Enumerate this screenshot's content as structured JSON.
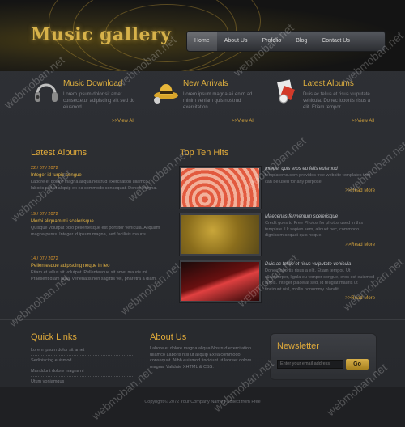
{
  "header": {
    "logo": "Music gallery",
    "nav": [
      "Home",
      "About Us",
      "Profolio",
      "Blog",
      "Contact Us"
    ]
  },
  "features": [
    {
      "title": "Music Download",
      "text": "Lorem ipsum dolor sit amet consectetur adipiscing elit sed do eiusmod",
      "more": ">>View All",
      "icon": "headphones-icon"
    },
    {
      "title": "New Arrivals",
      "text": "Lorem ipsum magna ali enim ad minim veniam quis nostrud exercitation",
      "more": ">>View All",
      "icon": "hat-icon"
    },
    {
      "title": "Latest Albums",
      "text": "Duis ac tellus et risus vulputate vehicula. Donec lobortis risus a elit. Etiam tempor.",
      "more": ">>View All",
      "icon": "album-icon"
    }
  ],
  "latest_albums": {
    "title": "Latest Albums",
    "items": [
      {
        "date": "22 / 07 / 2072",
        "title": "Integer id turpis congue",
        "text": "Labore et dolore magna aliqua nostrud exercitation ullamco laboris nisi ut aliquip ex ea commodo consequat. Donec magna."
      },
      {
        "date": "19 / 07 / 2072",
        "title": "Morbi aliquam mi scelerisque",
        "text": "Quisque volutpat odio pellentesque est porttitor vehicula. Aliquam magna purus. Integer id ipsum magna, sed facilisis mauris."
      },
      {
        "date": "14 / 07 / 2072",
        "title": "Pellentesque adipiscing neque in leo",
        "text": "Etiam et tellus sit volutpat. Pellentesque sit amet mauris mi. Praesent diam urna, venenatis non sagittis vel, pharetra a diam."
      }
    ]
  },
  "top_hits": {
    "title": "Top Ten Hits",
    "items": [
      {
        "title": "Integer quis eros eu felis euismod",
        "text": "templatemo.com provides free website templates that can be used for any purpose.",
        "more": ">>Read More"
      },
      {
        "title": "Maecenas fermentum scelerisque",
        "text": "Credit goes to Free Photos for photos used in this template. Ut sapien sem, aliquet nec, commodo dignissim sequat quis neque.",
        "more": ">>Read More"
      },
      {
        "title": "Duis ac tellus et risus vulputate vehicula",
        "text": "Donec lobortis risus a elit. Etiam tempor. Ut ullamcorper, ligula eu tempor congue, eros est euismod turpis. Integer placerat sed, id feugiat mauris ut tincidunt nisl, mollis nonummy blandit.",
        "more": ">>Read More"
      }
    ]
  },
  "quick_links": {
    "title": "Quick Links",
    "items": [
      "Lorem ipsum dolor sit amet",
      "Sedipiscing euismod",
      "Manddunt dolore magna ni",
      "Utum voniamqus"
    ]
  },
  "about": {
    "title": "About Us",
    "text": "Labore et dolore magna aliqua Nostrud exercitation ullamco Laboris nisi ut aliquip Exea commodo consequat. Nibh euismod tincidunt ut laoreet dolore magna. Validate XHTML & CSS."
  },
  "newsletter": {
    "title": "Newsletter",
    "placeholder": "Enter your email address",
    "button": "Go"
  },
  "footer": {
    "text": "Copyright © 2072 Your Company Name | Collect from Free"
  },
  "watermark": "webmoban.net",
  "colors": {
    "accent": "#e0aa3a",
    "background": "#2b2d31"
  }
}
